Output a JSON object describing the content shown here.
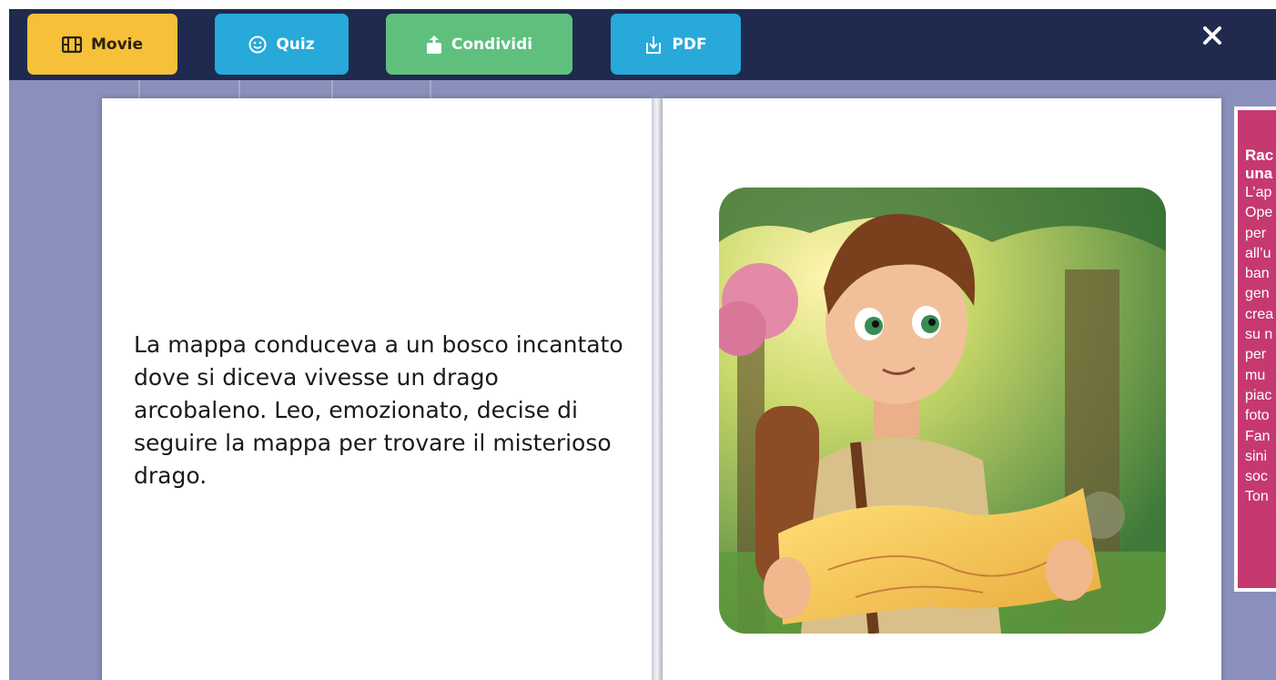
{
  "toolbar": {
    "movie_label": "Movie",
    "quiz_label": "Quiz",
    "share_label": "Condividi",
    "pdf_label": "PDF",
    "close_icon": "close-icon",
    "colors": {
      "bar": "#1f2a4e",
      "movie": "#f6c038",
      "quiz": "#27a9d9",
      "share": "#5fc07e",
      "pdf": "#27a9d9"
    }
  },
  "book": {
    "left_page_text": "La mappa conduceva a un bosco incantato dove si diceva vivesse un drago arcobaleno. Leo, emozionato, decise di seguire la mappa per trovare il misterioso drago.",
    "right_page_image": "illustration-boy-with-map"
  },
  "sidebar": {
    "color": "#c53970",
    "title_lines": [
      "Rac",
      "una"
    ],
    "lines": [
      "L’ap",
      "Ope",
      "per",
      "all’u",
      "ban",
      "gen",
      "crea",
      "su n",
      "per",
      "mu",
      "piac",
      "foto",
      "Fan",
      "sini",
      "soc",
      "Ton"
    ]
  }
}
